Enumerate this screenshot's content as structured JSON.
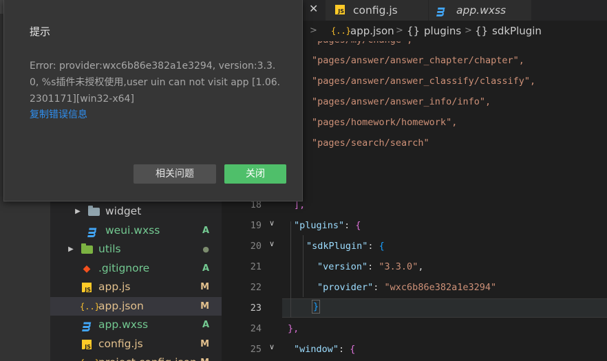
{
  "tabs": [
    {
      "label": "config.js",
      "icon": "js-file-icon"
    },
    {
      "label": "app.wxss",
      "icon": "css-file-icon"
    }
  ],
  "breadcrumb": {
    "file": "app.json",
    "segment1": "plugins",
    "segment2": "sdkPlugin",
    "sep": ">",
    "obj": "{}"
  },
  "explorer": {
    "items": [
      {
        "label": "widget",
        "status": ""
      },
      {
        "label": "weui.wxss",
        "status": "A"
      },
      {
        "label": "utils",
        "status": "●"
      },
      {
        "label": ".gitignore",
        "status": "A"
      },
      {
        "label": "app.js",
        "status": "M"
      },
      {
        "label": "app.json",
        "status": "M"
      },
      {
        "label": "app.wxss",
        "status": "A"
      },
      {
        "label": "config.js",
        "status": "M"
      },
      {
        "label": "project.config.json",
        "status": "M"
      }
    ]
  },
  "editor": {
    "lines": [
      {
        "num": "",
        "text": "\"pages/my/change\","
      },
      {
        "num": "",
        "text": "\"pages/answer/answer_chapter/chapter\","
      },
      {
        "num": "",
        "text": "\"pages/answer/answer_classify/classify\","
      },
      {
        "num": "",
        "text": "\"pages/answer/answer_info/info\","
      },
      {
        "num": "",
        "text": "\"pages/homework/homework\","
      },
      {
        "num": "",
        "text": "\"pages/search/search\""
      },
      {
        "num": "18",
        "text": "],"
      },
      {
        "num": "19",
        "text": "\"plugins\": {"
      },
      {
        "num": "20",
        "text": "\"sdkPlugin\": {"
      },
      {
        "num": "21",
        "text": "\"version\": \"3.3.0\","
      },
      {
        "num": "22",
        "text": "\"provider\": \"wxc6b86e382a1e3294\""
      },
      {
        "num": "23",
        "text": "}"
      },
      {
        "num": "24",
        "text": "},"
      },
      {
        "num": "25",
        "text": "\"window\": {"
      }
    ],
    "tokens": {
      "plugins_key": "\"plugins\"",
      "sdk_key": "\"sdkPlugin\"",
      "version_key": "\"version\"",
      "version_val": "\"3.3.0\"",
      "provider_key": "\"provider\"",
      "provider_val": "\"wxc6b86e382a1e3294\"",
      "window_key": "\"window\"",
      "colon": ": ",
      "comma": ",",
      "open": "{",
      "close": "}",
      "bracket_close": "]"
    }
  },
  "dialog": {
    "title": "提示",
    "message": "Error: provider:wxc6b86e382a1e3294, version:3.3.0, %s插件未授权使用,user uin can not visit app [1.06.2301171][win32-x64]",
    "copy_link": "复制错误信息",
    "secondary_button": "相关问题",
    "primary_button": "关闭"
  }
}
